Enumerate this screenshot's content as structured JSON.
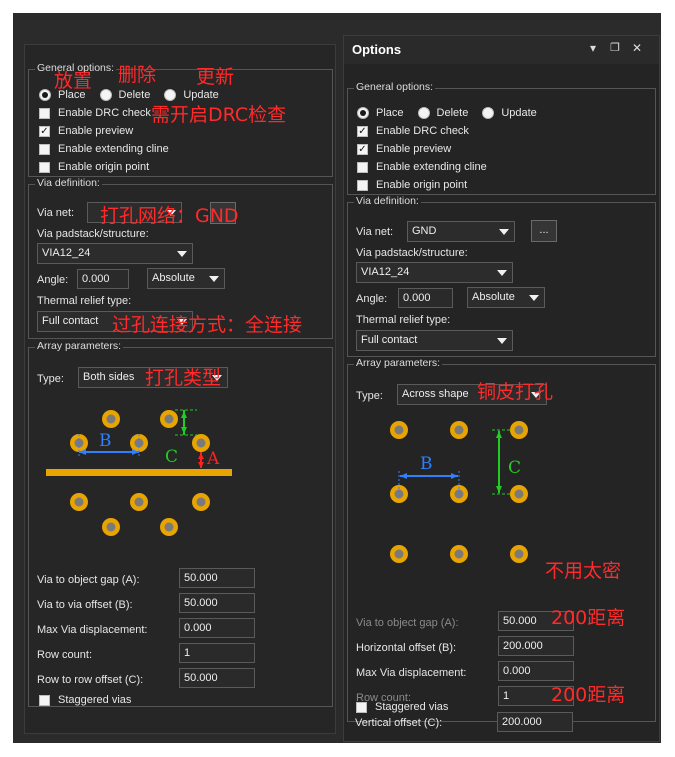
{
  "left": {
    "general_label": "General options:",
    "place": "Place",
    "delete": "Delete",
    "update": "Update",
    "drc": "Enable DRC check",
    "preview": "Enable preview",
    "extending": "Enable extending cline",
    "origin": "Enable origin point",
    "via_def_label": "Via definition:",
    "via_net_label": "Via net:",
    "padstack_label": "Via padstack/structure:",
    "padstack_value": "VIA12_24",
    "angle_label": "Angle:",
    "angle_value": "0.000",
    "angle_mode": "Absolute",
    "thermal_label": "Thermal relief type:",
    "thermal_value": "Full contact",
    "array_label": "Array parameters:",
    "type_label": "Type:",
    "type_value": "Both sides",
    "fields": [
      {
        "label": "Via to object gap (A):",
        "value": "50.000"
      },
      {
        "label": "Via to via offset (B):",
        "value": "50.000"
      },
      {
        "label": "Max Via displacement:",
        "value": "0.000"
      },
      {
        "label": "Row count:",
        "value": "1"
      },
      {
        "label": "Row to row offset (C):",
        "value": "50.000"
      }
    ],
    "staggered": "Staggered vias",
    "diagram": {
      "a": "A",
      "b": "B",
      "c": "C"
    }
  },
  "right": {
    "title": "Options",
    "icons": [
      "chevron-down-icon",
      "restore-icon",
      "close-icon"
    ],
    "general_label": "General options:",
    "place": "Place",
    "delete": "Delete",
    "update": "Update",
    "drc": "Enable DRC check",
    "preview": "Enable preview",
    "extending": "Enable extending cline",
    "origin": "Enable origin point",
    "via_def_label": "Via definition:",
    "via_net_label": "Via net:",
    "via_net_value": "GND",
    "browse": "...",
    "padstack_label": "Via padstack/structure:",
    "padstack_value": "VIA12_24",
    "angle_label": "Angle:",
    "angle_value": "0.000",
    "angle_mode": "Absolute",
    "thermal_label": "Thermal relief type:",
    "thermal_value": "Full contact",
    "array_label": "Array parameters:",
    "type_label": "Type:",
    "type_value": "Across shape",
    "fields": [
      {
        "label": "Via to object gap (A):",
        "value": "50.000",
        "enabled": false
      },
      {
        "label": "Horizontal offset (B):",
        "value": "200.000",
        "enabled": true
      },
      {
        "label": "Max Via displacement:",
        "value": "0.000",
        "enabled": true
      },
      {
        "label": "Row count:",
        "value": "1",
        "enabled": false
      },
      {
        "label": "Vertical offset (C):",
        "value": "200.000",
        "enabled": true
      }
    ],
    "staggered": "Staggered vias",
    "diagram": {
      "b": "B",
      "c": "C"
    }
  },
  "annotations": {
    "place": "放置",
    "delete": "删除",
    "update": "更新",
    "drc": "需开启DRC检查",
    "via_net": "打孔网络：GND",
    "thermal": "过孔连接方式：全连接",
    "type_left": "打孔类型",
    "type_right": "铜皮打孔",
    "gap": "不用太密",
    "h_offset": "200距离",
    "v_offset": "200距离"
  },
  "colors": {
    "annotation": "#ff2a2a",
    "via_pad": "#e8a400",
    "via_hole": "#7a7a7a",
    "dim_green": "#22cc22",
    "dim_blue": "#2f7fff",
    "dim_red": "#ff2020"
  }
}
